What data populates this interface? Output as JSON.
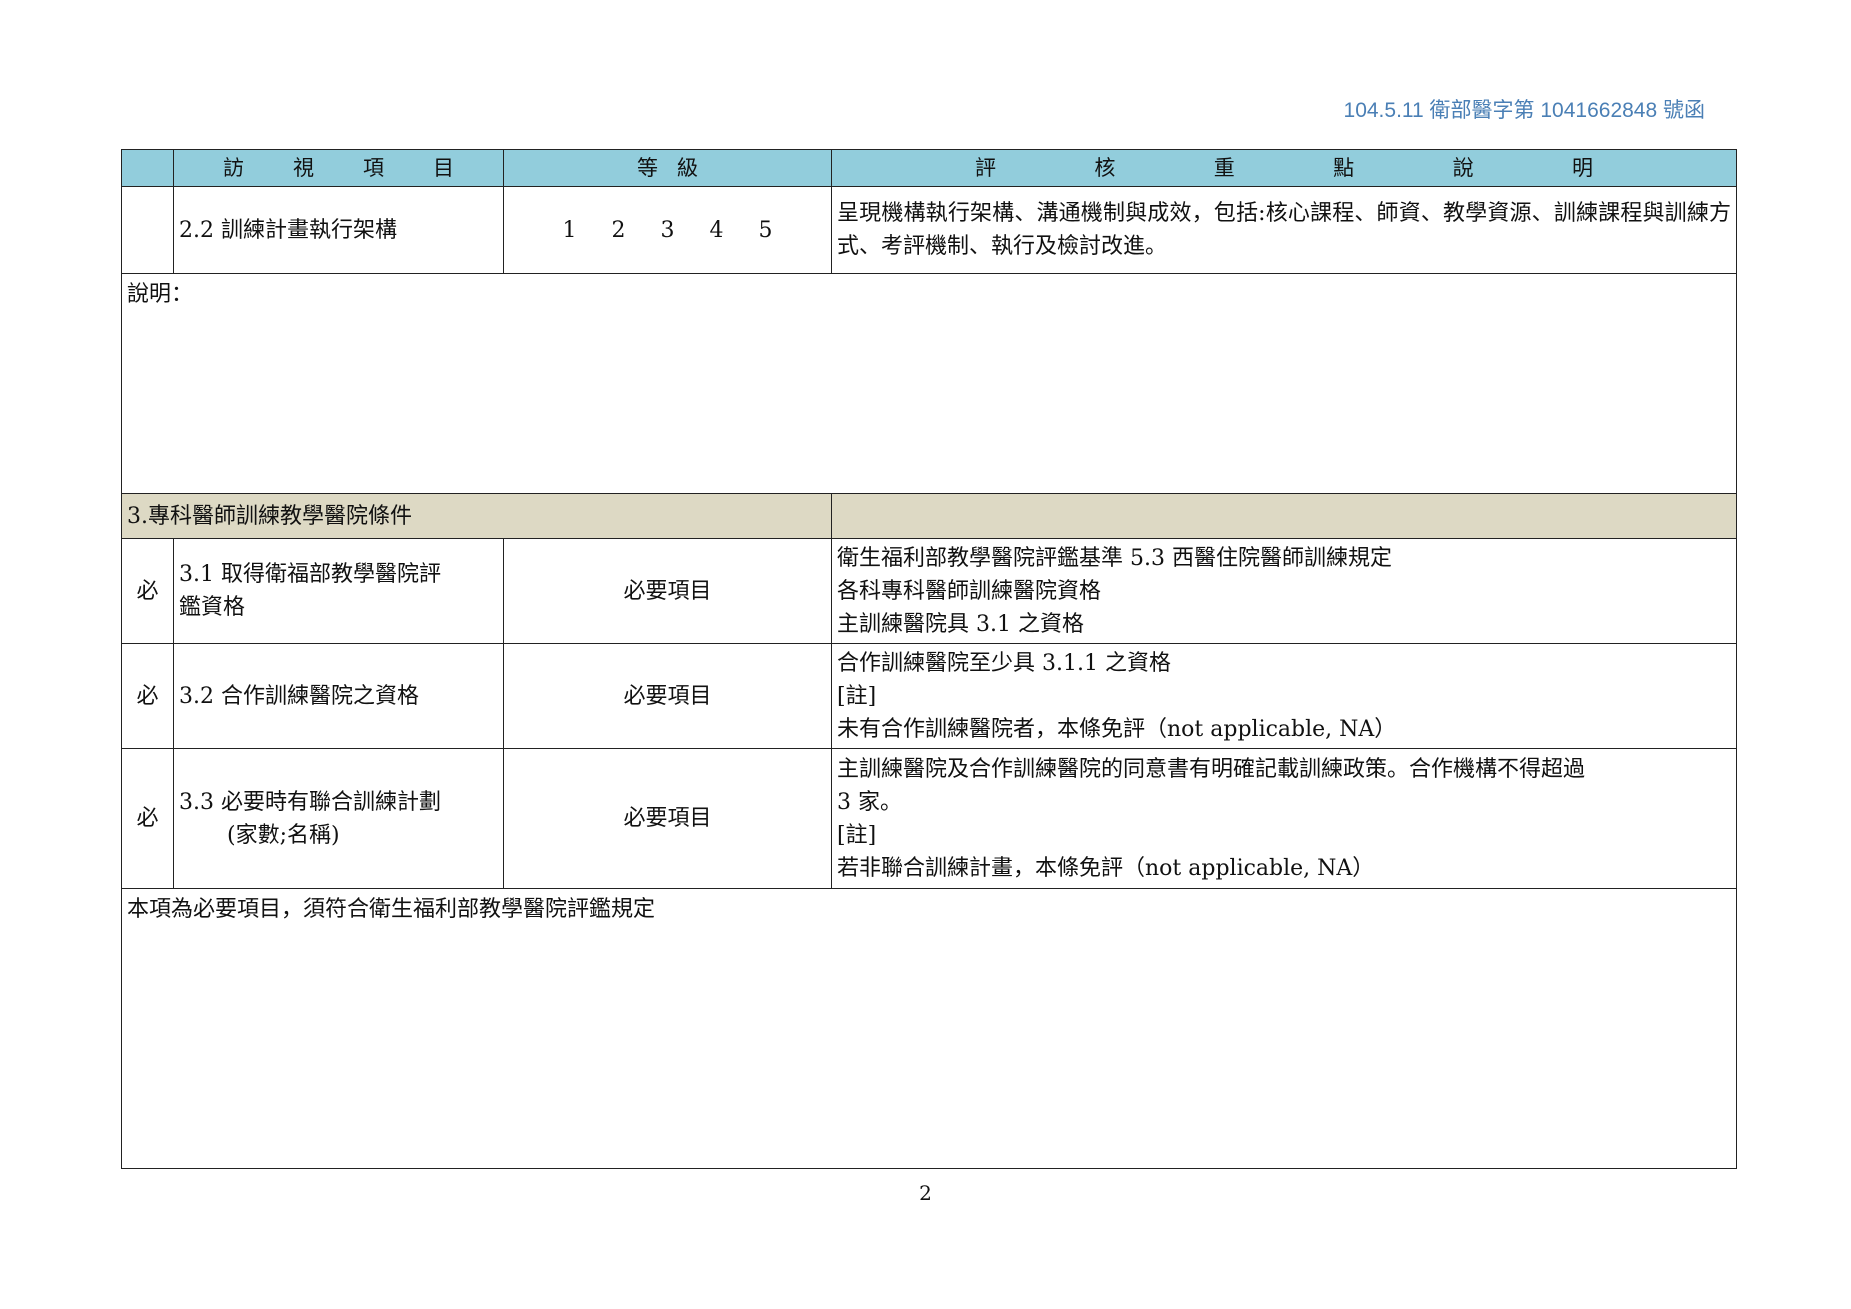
{
  "doc_ref": "104.5.11 衛部醫字第 1041662848 號函",
  "header": {
    "item_chars": [
      "訪",
      "視",
      "項",
      "目"
    ],
    "grade_chars": [
      "等",
      "級"
    ],
    "criteria_chars": [
      "評",
      "核",
      "重",
      "點",
      "說",
      "明"
    ]
  },
  "row_2_2": {
    "item": "2.2 訓練計畫執行架構",
    "grades": [
      "1",
      "2",
      "3",
      "4",
      "5"
    ],
    "criteria": "呈現機構執行架構、溝通機制與成效，包括:核心課程、師資、教學資源、訓練課程與訓練方式、考評機制、執行及檢討改進。"
  },
  "note_2": {
    "label": "說明："
  },
  "section_3": {
    "title": "3.專科醫師訓練教學醫院條件"
  },
  "rows_3": [
    {
      "mark": "必",
      "item_lines": [
        "3.1 取得衛福部教學醫院評",
        "鑑資格"
      ],
      "grade": "必要項目",
      "criteria_lines": [
        "衛生福利部教學醫院評鑑基準 5.3 西醫住院醫師訓練規定",
        "各科專科醫師訓練醫院資格",
        "主訓練醫院具 3.1 之資格"
      ]
    },
    {
      "mark": "必",
      "item_lines": [
        "3.2 合作訓練醫院之資格"
      ],
      "grade": "必要項目",
      "criteria_lines": [
        "合作訓練醫院至少具 3.1.1 之資格",
        "[註]",
        "未有合作訓練醫院者，本條免評（not applicable, NA）"
      ]
    },
    {
      "mark": "必",
      "item_lines": [
        "3.3 必要時有聯合訓練計劃",
        "(家數;名稱)"
      ],
      "grade": "必要項目",
      "criteria_lines": [
        "主訓練醫院及合作訓練醫院的同意書有明確記載訓練政策。合作機構不得超過",
        "3 家。",
        "[註]",
        "若非聯合訓練計畫，本條免評（not applicable, NA）"
      ]
    }
  ],
  "note_3": {
    "text": "本項為必要項目，須符合衛生福利部教學醫院評鑑規定"
  },
  "page_number": "2"
}
